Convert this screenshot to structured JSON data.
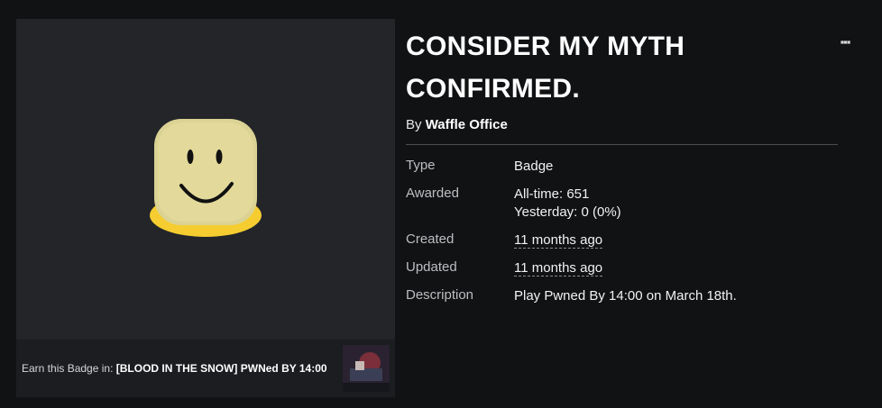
{
  "badge": {
    "title": "CONSIDER MY MYTH CONFIRMED.",
    "creator_prefix": "By",
    "creator_name": "Waffle Office",
    "earn_prefix": "Earn this Badge in:",
    "earn_game": "[BLOOD IN THE SNOW] PWNed BY 14:00",
    "image_icon": "noob-head-icon",
    "game_thumbnail_icon": "game-thumbnail"
  },
  "info": {
    "type_label": "Type",
    "type_value": "Badge",
    "awarded_label": "Awarded",
    "awarded_alltime": "All-time: 651",
    "awarded_yesterday": "Yesterday: 0 (0%)",
    "created_label": "Created",
    "created_value": "11 months ago",
    "updated_label": "Updated",
    "updated_value": "11 months ago",
    "description_label": "Description",
    "description_value": "Play Pwned By 14:00 on March 18th."
  },
  "menu": {
    "more_icon": "ellipsis-icon",
    "more_glyph": "▪▪▪"
  },
  "colors": {
    "background": "#111214",
    "panel": "#232529",
    "head_yellow": "#f5cd30"
  }
}
